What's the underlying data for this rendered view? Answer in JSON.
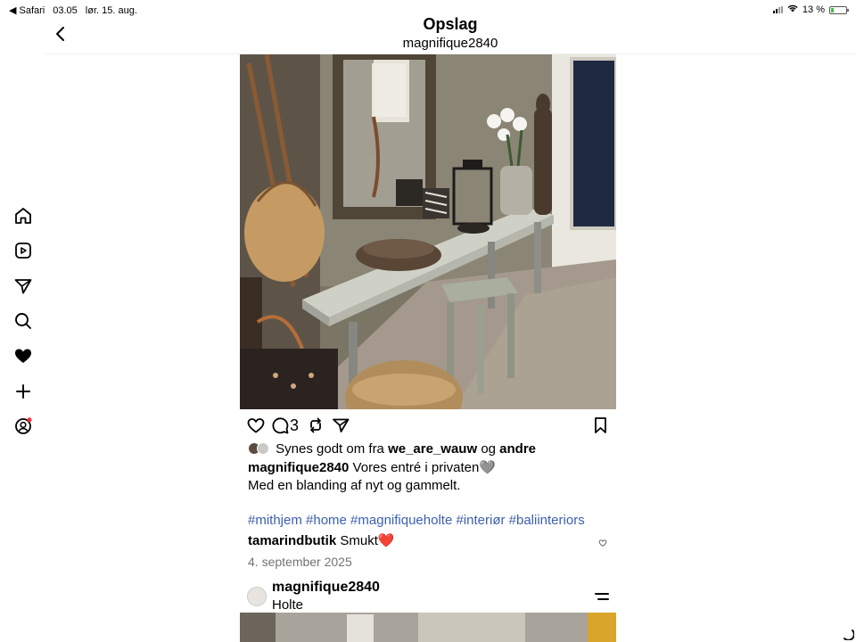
{
  "status_bar": {
    "back_app": "◀ Safari",
    "time": "03.05",
    "date": "lør. 15. aug.",
    "battery": "13 %"
  },
  "header": {
    "title": "Opslag",
    "username": "magnifique2840"
  },
  "sidebar": {
    "icons": [
      "home-icon",
      "reels-icon",
      "direct-icon",
      "search-icon",
      "notifications-icon",
      "create-icon",
      "profile-icon"
    ]
  },
  "post": {
    "comment_count": "3",
    "likes": {
      "prefix": "Synes godt om fra",
      "user": "we_are_wauw",
      "joiner": "og",
      "others": "andre"
    },
    "caption": {
      "user": "magnifique2840",
      "text": "Vores entré i privaten🩶",
      "line2": "Med en blanding af nyt og gammelt."
    },
    "hashtags": "#mithjem #home #magnifiqueholte #interiør #baliinteriors",
    "comment": {
      "user": "tamarindbutik",
      "text": "Smukt❤️"
    },
    "date": "4. september 2025"
  },
  "next_post": {
    "user": "magnifique2840",
    "location": "Holte"
  },
  "colors": {
    "accent": "#3b5fb0",
    "heart": "#ff3040",
    "muted": "#737373"
  }
}
